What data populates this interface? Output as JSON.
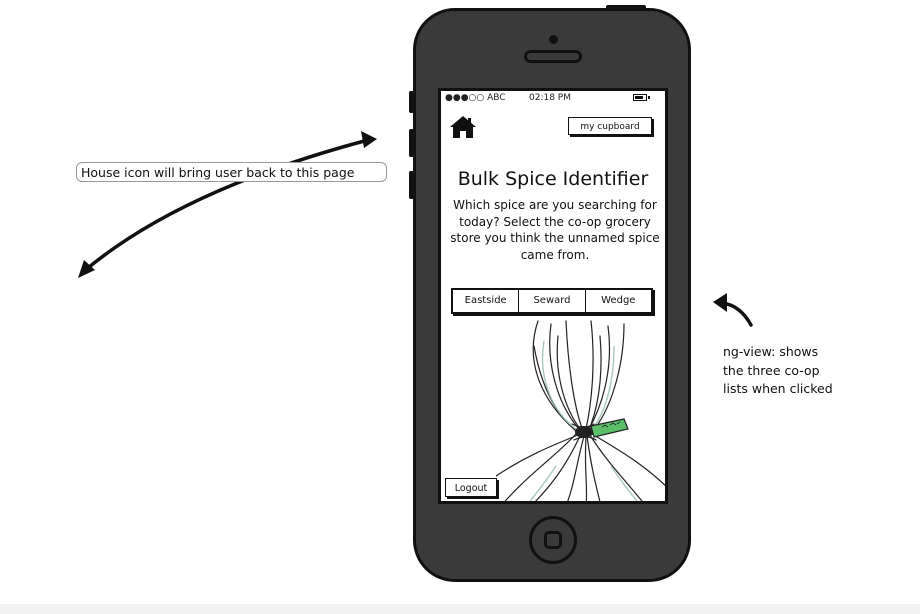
{
  "status_bar": {
    "carrier": "●●●○○ ABC",
    "time": "02:18 PM"
  },
  "header": {
    "home_icon": "house-icon",
    "cupboard_button": "my cupboard"
  },
  "main": {
    "title": "Bulk Spice Identifier",
    "description": "Which spice are you searching for today?  Select the co-op grocery store you think the unnamed spice came from.",
    "tabs": [
      {
        "label": "Eastside"
      },
      {
        "label": "Seward"
      },
      {
        "label": "Wedge"
      }
    ]
  },
  "footer": {
    "logout_button": "Logout"
  },
  "annotations": {
    "house_note": "House icon will bring user back to this page",
    "ngview_note": "ng-view: shows\nthe three co-op\nlists when clicked"
  },
  "colors": {
    "phone_body": "#3a3a3a",
    "outline": "#111111",
    "twist_tie": "#5bbf6a"
  }
}
